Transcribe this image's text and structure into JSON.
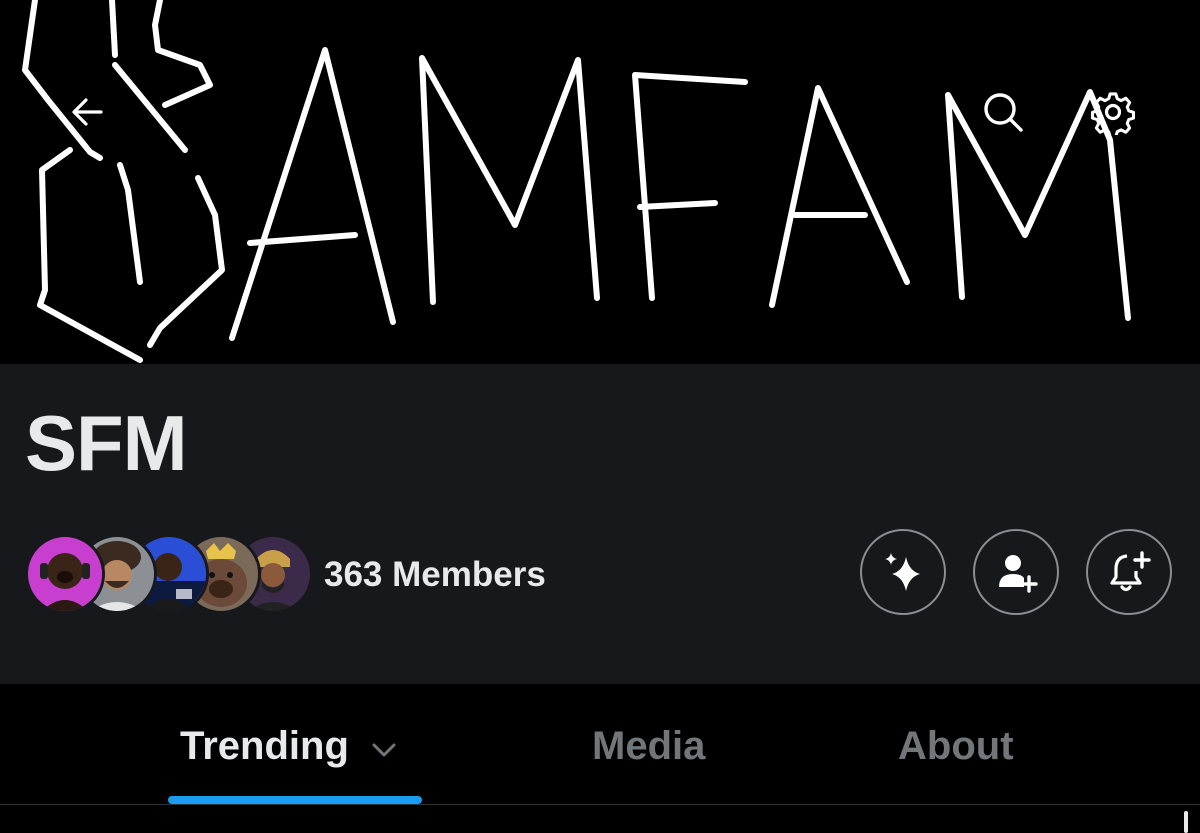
{
  "banner": {
    "artwork": "hand-drawn white lettering on black reading \"SAMFAM\"",
    "background": "#000000"
  },
  "header": {
    "back_icon": "arrow-left-icon",
    "search_icon": "search-icon",
    "settings_icon": "gear-icon"
  },
  "community": {
    "name": "SFM",
    "members_label": "363 Members",
    "member_avatars": [
      {
        "name": "member-avatar-1",
        "bg": "#c83fd0"
      },
      {
        "name": "member-avatar-2",
        "bg": "#8c8f93"
      },
      {
        "name": "member-avatar-3",
        "bg": "#2a4fd6"
      },
      {
        "name": "member-avatar-4",
        "bg": "#6b4a3a"
      },
      {
        "name": "member-avatar-5",
        "bg": "#3b2a4a"
      }
    ],
    "actions": [
      {
        "name": "sparkle-icon"
      },
      {
        "name": "add-member-icon"
      },
      {
        "name": "bell-plus-icon"
      }
    ]
  },
  "tabs": [
    {
      "label": "Trending",
      "selected": true,
      "icon": "chevron-down-icon"
    },
    {
      "label": "Media",
      "selected": false
    },
    {
      "label": "About",
      "selected": false
    }
  ],
  "colors": {
    "accent": "#1d9bf0",
    "panel": "#16181c",
    "text_primary": "#e7e9ea",
    "text_secondary": "#71767b"
  }
}
